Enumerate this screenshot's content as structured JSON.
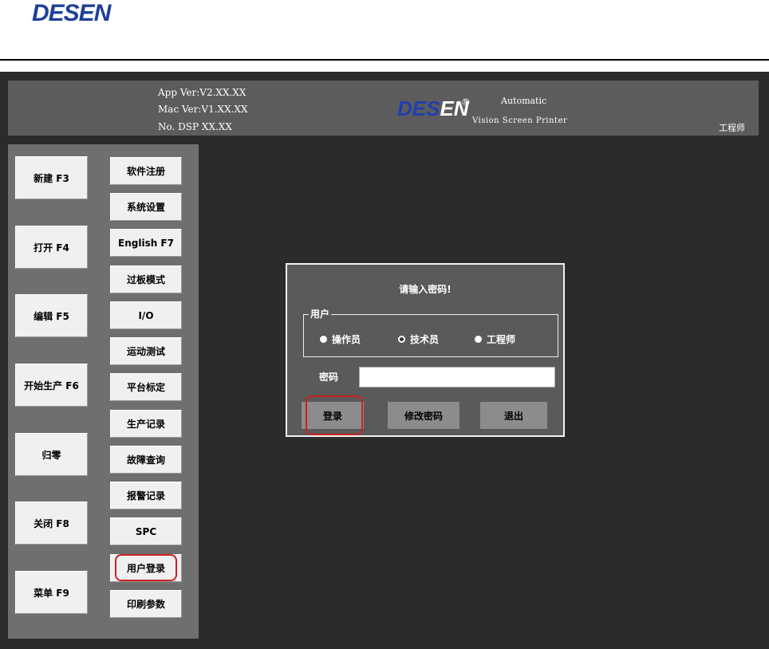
{
  "doc_header": {
    "logo": "DESEN"
  },
  "top_banner": {
    "app_ver": "App Ver:V2.XX.XX",
    "mac_ver": "Mac Ver:V1.XX.XX",
    "dsp_ver": "No. DSP XX.XX",
    "logo_main": "DES",
    "logo_tail": "EN",
    "reg_mark": "®",
    "tagline_1": "Automatic",
    "tagline_2": "Vision Screen Printer",
    "role": "工程师"
  },
  "main_buttons": [
    {
      "label": "新建 F3"
    },
    {
      "label": "打开 F4"
    },
    {
      "label": "编辑 F5"
    },
    {
      "label": "开始生产 F6"
    },
    {
      "label": "归零"
    },
    {
      "label": "关闭 F8"
    },
    {
      "label": "菜单 F9"
    }
  ],
  "side_buttons": [
    {
      "label": "软件注册"
    },
    {
      "label": "系统设置"
    },
    {
      "label": "English F7"
    },
    {
      "label": "过板模式"
    },
    {
      "label": "I/O"
    },
    {
      "label": "运动测试"
    },
    {
      "label": "平台标定"
    },
    {
      "label": "生产记录"
    },
    {
      "label": "故障查询"
    },
    {
      "label": "报警记录"
    },
    {
      "label": "SPC"
    },
    {
      "label": "用户登录"
    },
    {
      "label": "印刷参数"
    }
  ],
  "login_dialog": {
    "title": "请输入密码!",
    "group_label": "用户",
    "radios": [
      {
        "label": "操作员",
        "checked": false
      },
      {
        "label": "技术员",
        "checked": true
      },
      {
        "label": "工程师",
        "checked": false
      }
    ],
    "password_label": "密码",
    "password_value": "",
    "login_label": "登录",
    "change_pwd_label": "修改密码",
    "exit_label": "退出"
  },
  "colors": {
    "screen_bg": "#2b2b2b",
    "banner_bg": "#5c5c5c",
    "panel_bg": "#6f6f6f",
    "dialog_bg": "#5a5a5a",
    "brand_blue": "#1f3fb0",
    "highlight_red": "#cc2020"
  }
}
